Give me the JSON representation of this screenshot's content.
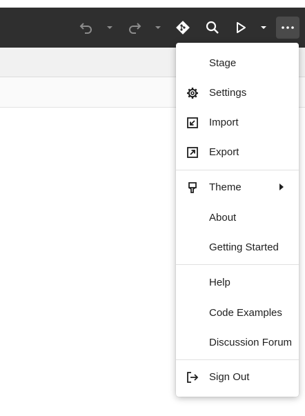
{
  "toolbar": {
    "icons": [
      "undo-icon",
      "chevron-down-icon",
      "redo-icon",
      "chevron-down-icon",
      "git-icon",
      "search-icon",
      "run-icon",
      "chevron-down-icon",
      "more-icon"
    ]
  },
  "menu": {
    "items": [
      {
        "label": "Stage",
        "icon": ""
      },
      {
        "label": "Settings",
        "icon": "gear-icon"
      },
      {
        "label": "Import",
        "icon": "import-icon"
      },
      {
        "label": "Export",
        "icon": "export-icon"
      },
      {
        "label": "Theme",
        "icon": "brush-icon",
        "submenu": true
      },
      {
        "label": "About",
        "icon": ""
      },
      {
        "label": "Getting Started",
        "icon": ""
      },
      {
        "label": "Help",
        "icon": ""
      },
      {
        "label": "Code Examples",
        "icon": ""
      },
      {
        "label": "Discussion Forum",
        "icon": ""
      },
      {
        "label": "Sign Out",
        "icon": "sign-out-icon"
      }
    ]
  }
}
